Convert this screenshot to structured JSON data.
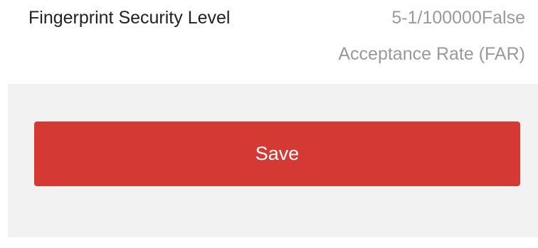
{
  "setting": {
    "label": "Fingerprint Security Level",
    "value_line1": "5-1/100000False",
    "value_line2": "Acceptance Rate (FAR)"
  },
  "actions": {
    "save_label": "Save"
  },
  "colors": {
    "accent": "#d43a33",
    "footer_background": "#f2f2f2",
    "value_text": "#9a9a9a",
    "label_text": "#222222"
  }
}
